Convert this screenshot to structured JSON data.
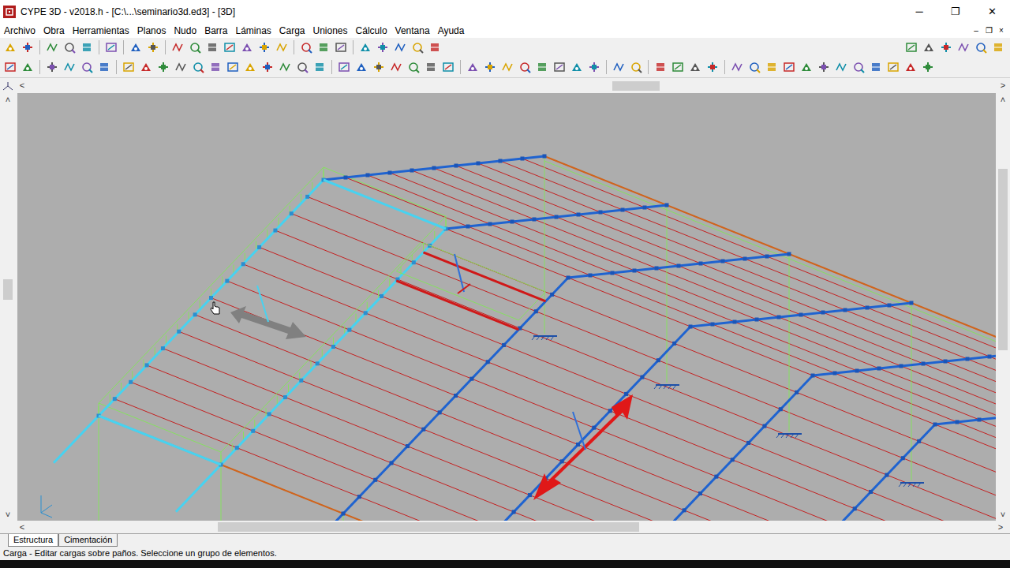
{
  "window": {
    "title": "CYPE 3D - v2018.h - [C:\\...\\seminario3d.ed3] - [3D]",
    "controls": [
      "─",
      "❐",
      "✕"
    ]
  },
  "menu": [
    "Archivo",
    "Obra",
    "Herramientas",
    "Planos",
    "Nudo",
    "Barra",
    "Láminas",
    "Carga",
    "Uniones",
    "Cálculo",
    "Ventana",
    "Ayuda"
  ],
  "mdi_controls": [
    "–",
    "❐",
    "×"
  ],
  "scroll_arrows": {
    "left": "<",
    "right": ">",
    "up": "˄",
    "down": "˅"
  },
  "tabs": [
    {
      "label": "Estructura",
      "selected": true
    },
    {
      "label": "Cimentación",
      "selected": false
    }
  ],
  "status_bar": "Carga - Editar cargas sobre paños. Seleccione un grupo de elementos."
}
